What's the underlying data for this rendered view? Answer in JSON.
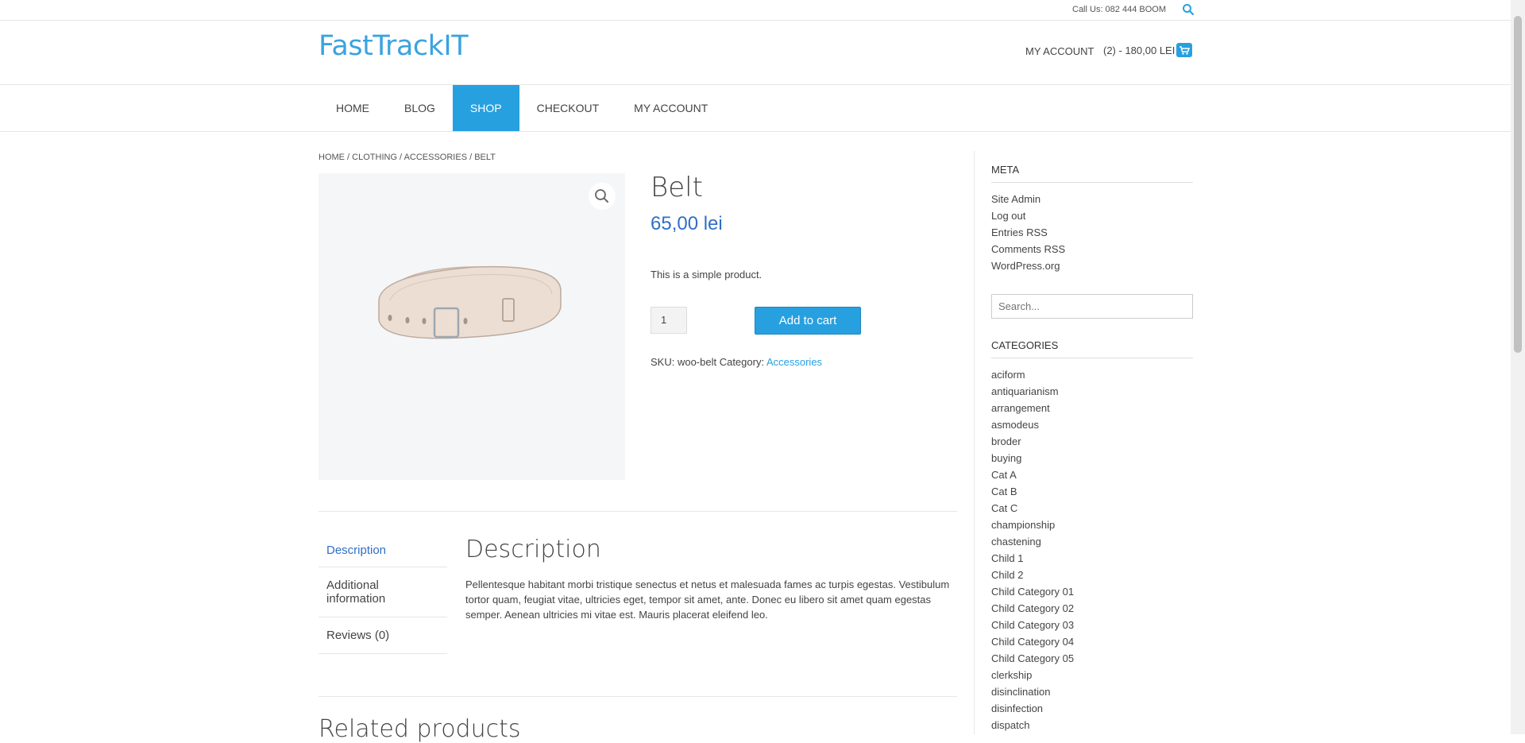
{
  "topbar": {
    "call": "Call Us: 082 444 BOOM"
  },
  "header": {
    "logo": "FastTrackIT",
    "my_account": "MY ACCOUNT",
    "cart": "(2) - 180,00 LEI"
  },
  "nav": {
    "items": [
      "HOME",
      "BLOG",
      "SHOP",
      "CHECKOUT",
      "MY ACCOUNT"
    ],
    "active": "SHOP"
  },
  "breadcrumb": "HOME / CLOTHING / ACCESSORIES / BELT",
  "product": {
    "title": "Belt",
    "price": "65,00 lei",
    "short_description": "This is a simple product.",
    "quantity": "1",
    "add_to_cart": "Add to cart",
    "sku_text": "SKU: woo-belt Category: ",
    "category": "Accessories"
  },
  "tabs": {
    "description": "Description",
    "additional": "Additional information",
    "reviews": "Reviews (0)"
  },
  "description": {
    "heading": "Description",
    "text": "Pellentesque habitant morbi tristique senectus et netus et malesuada fames ac turpis egestas. Vestibulum tortor quam, feugiat vitae, ultricies eget, tempor sit amet, ante. Donec eu libero sit amet quam egestas semper. Aenean ultricies mi vitae est. Mauris placerat eleifend leo."
  },
  "related": {
    "heading": "Related products"
  },
  "sidebar": {
    "meta_title": "META",
    "meta_links": [
      "Site Admin",
      "Log out",
      "Entries RSS",
      "Comments RSS",
      "WordPress.org"
    ],
    "search_placeholder": "Search...",
    "categories_title": "CATEGORIES",
    "categories": [
      "aciform",
      "antiquarianism",
      "arrangement",
      "asmodeus",
      "broder",
      "buying",
      "Cat A",
      "Cat B",
      "Cat C",
      "championship",
      "chastening",
      "Child 1",
      "Child 2",
      "Child Category 01",
      "Child Category 02",
      "Child Category 03",
      "Child Category 04",
      "Child Category 05",
      "clerkship",
      "disinclination",
      "disinfection",
      "dispatch"
    ]
  },
  "colors": {
    "accent": "#27a0e0",
    "price": "#2f6fc7"
  }
}
